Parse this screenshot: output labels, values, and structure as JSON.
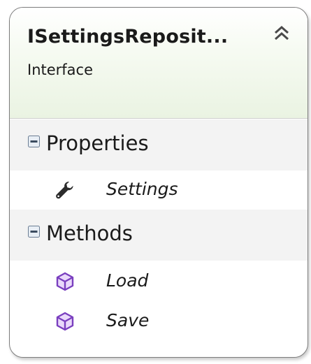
{
  "header": {
    "title": "ISettingsReposit...",
    "subtitle": "Interface"
  },
  "sections": {
    "properties": {
      "label": "Properties",
      "items": [
        {
          "name": "Settings",
          "icon": "wrench-icon"
        }
      ]
    },
    "methods": {
      "label": "Methods",
      "items": [
        {
          "name": "Load",
          "icon": "method-cube-icon"
        },
        {
          "name": "Save",
          "icon": "method-cube-icon"
        }
      ]
    }
  },
  "colors": {
    "header_gradient_end": "#eaf3e2",
    "section_band": "#f3f3f3",
    "method_icon": "#7a3fbf",
    "border": "#7d7d7d"
  }
}
